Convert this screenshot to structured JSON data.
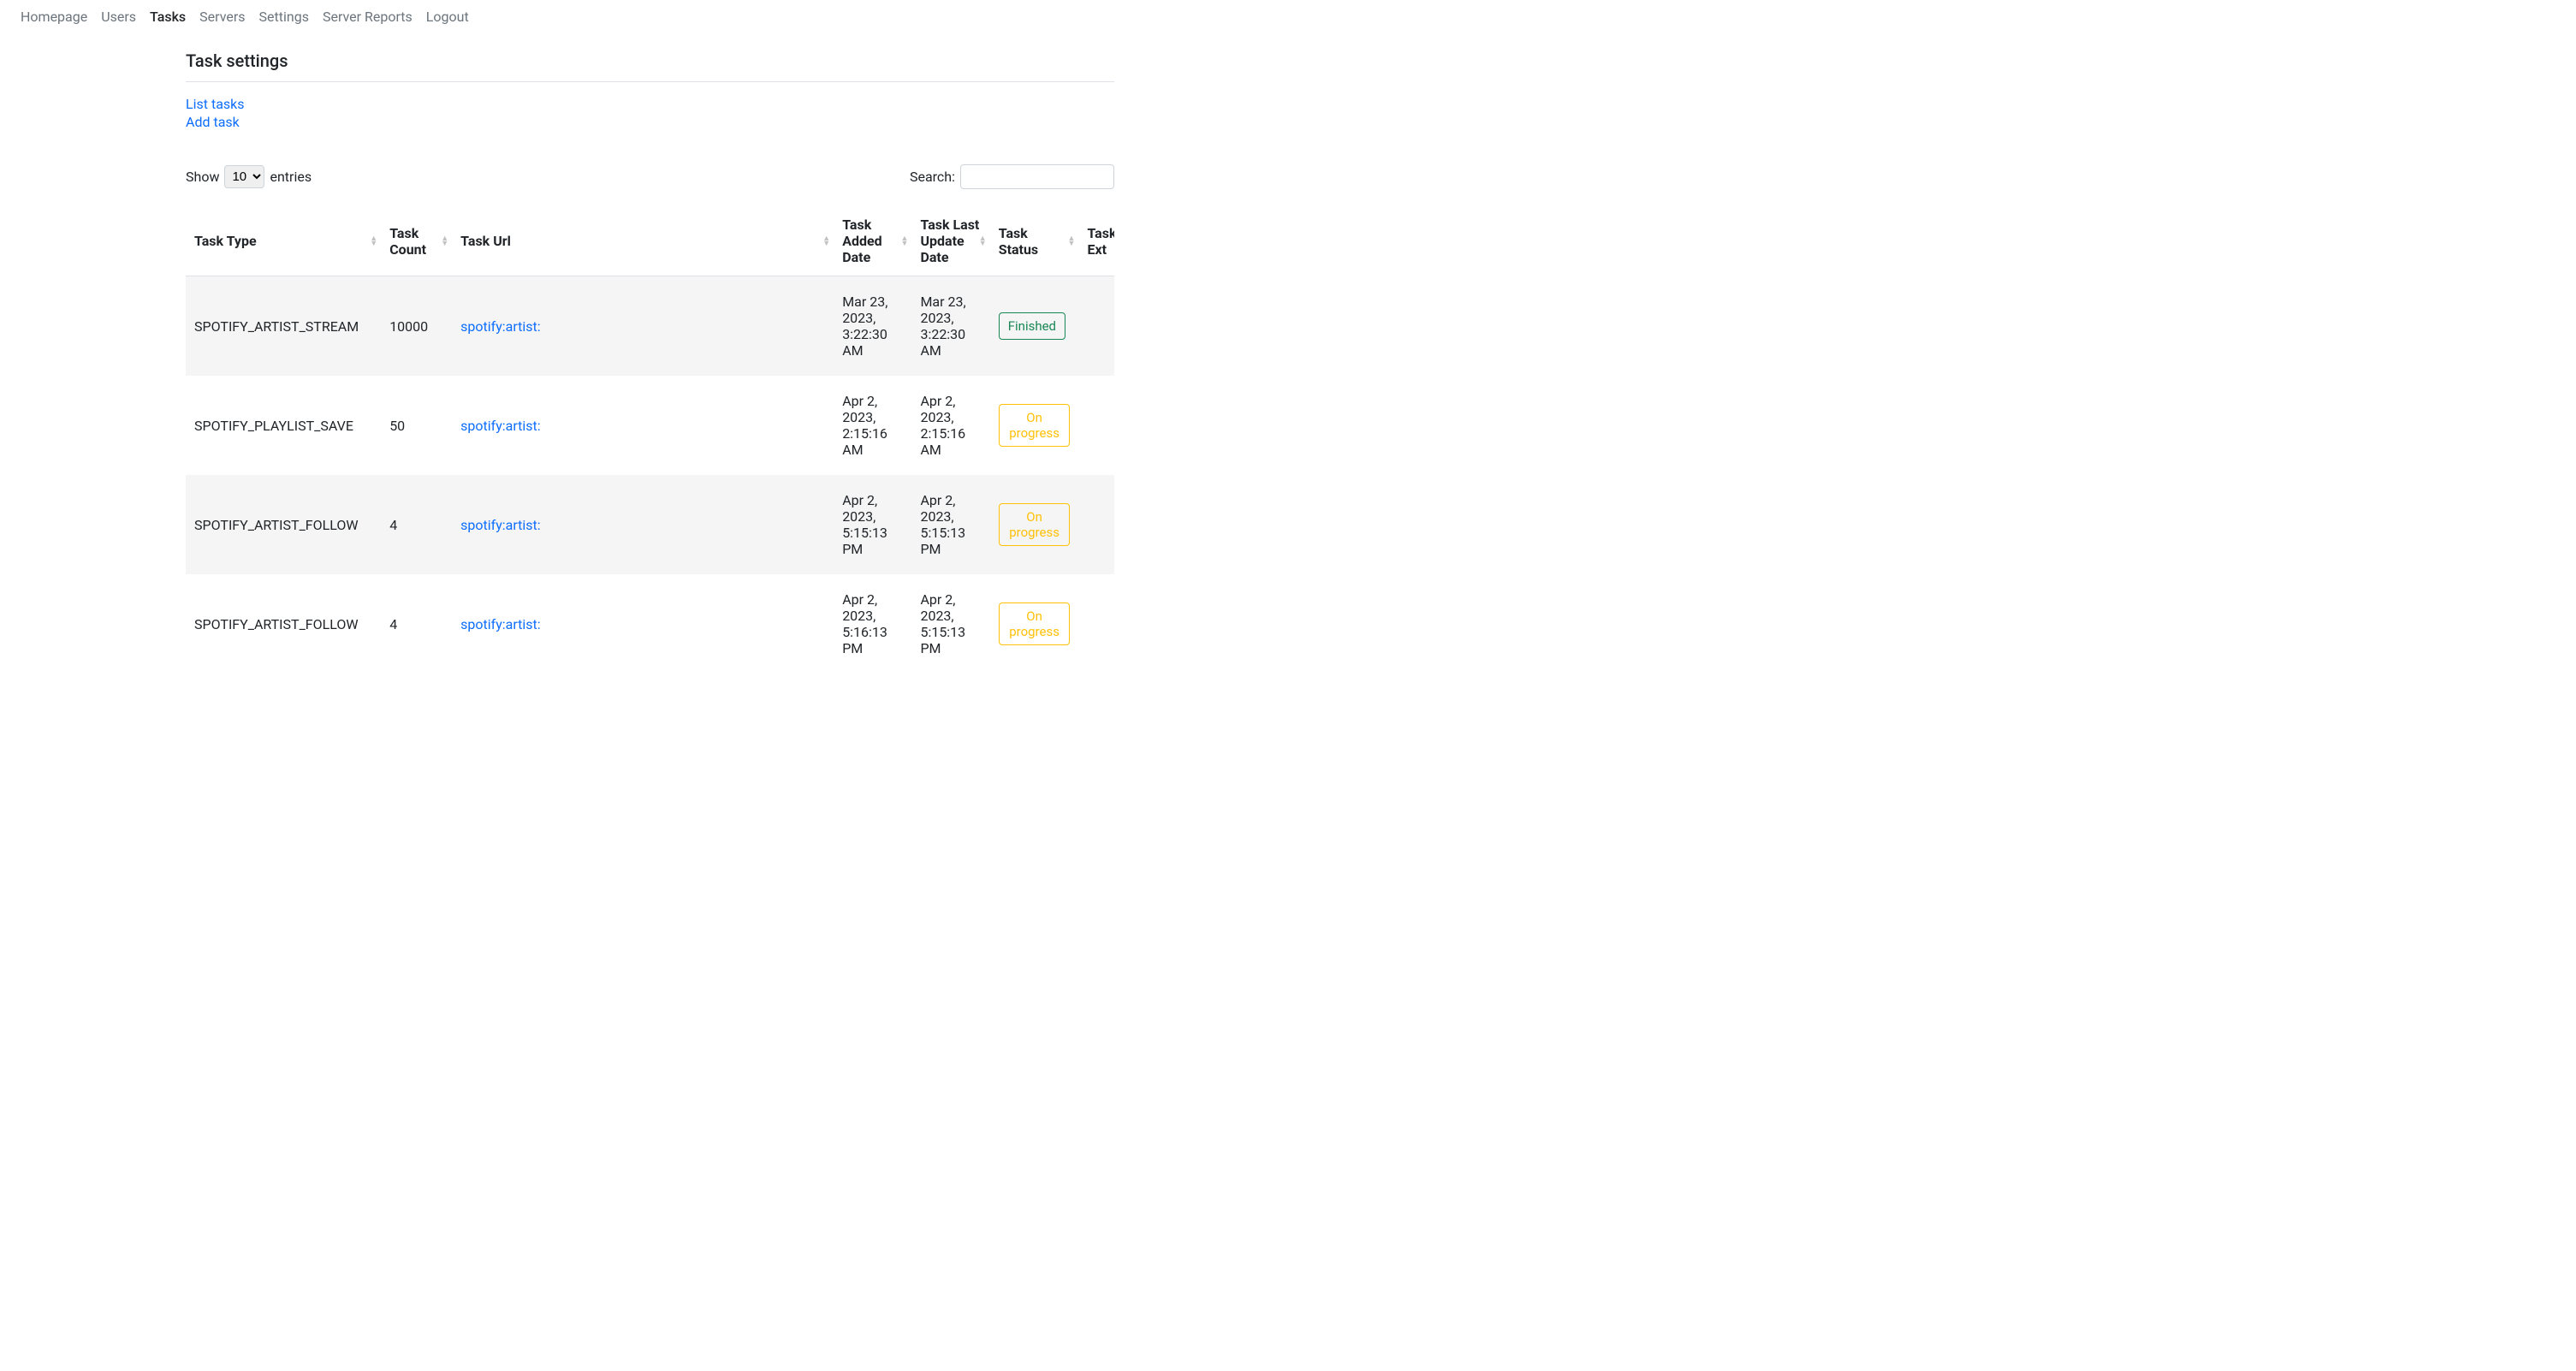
{
  "nav": {
    "items": [
      {
        "label": "Homepage",
        "active": false
      },
      {
        "label": "Users",
        "active": false
      },
      {
        "label": "Tasks",
        "active": true
      },
      {
        "label": "Servers",
        "active": false
      },
      {
        "label": "Settings",
        "active": false
      },
      {
        "label": "Server Reports",
        "active": false
      },
      {
        "label": "Logout",
        "active": false
      }
    ]
  },
  "page": {
    "title": "Task settings",
    "sublinks": [
      {
        "label": "List tasks"
      },
      {
        "label": "Add task"
      }
    ]
  },
  "table_controls": {
    "show_prefix": "Show",
    "show_suffix": "entries",
    "entries_selected": "10",
    "entries_options": [
      "10"
    ],
    "search_label": "Search:",
    "search_value": ""
  },
  "columns": [
    {
      "label": "Task Type",
      "cls": "col-type"
    },
    {
      "label": "Task Count",
      "cls": "col-count"
    },
    {
      "label": "Task Url",
      "cls": "col-url"
    },
    {
      "label": "Task Added Date",
      "cls": "col-added"
    },
    {
      "label": "Task Last Update Date",
      "cls": "col-update"
    },
    {
      "label": "Task Status",
      "cls": "col-status"
    },
    {
      "label": "Task Ext",
      "cls": "col-ext"
    }
  ],
  "rows": [
    {
      "type": "SPOTIFY_ARTIST_STREAM",
      "count": "10000",
      "url": "spotify:artist:",
      "added": "Mar 23, 2023, 3:22:30 AM",
      "updated": "Mar 23, 2023, 3:22:30 AM",
      "status": "Finished",
      "status_kind": "finished"
    },
    {
      "type": "SPOTIFY_PLAYLIST_SAVE",
      "count": "50",
      "url": "spotify:artist:",
      "added": "Apr 2, 2023, 2:15:16 AM",
      "updated": "Apr 2, 2023, 2:15:16 AM",
      "status": "On progress",
      "status_kind": "progress"
    },
    {
      "type": "SPOTIFY_ARTIST_FOLLOW",
      "count": "4",
      "url": "spotify:artist:",
      "added": "Apr 2, 2023, 5:15:13 PM",
      "updated": "Apr 2, 2023, 5:15:13 PM",
      "status": "On progress",
      "status_kind": "progress"
    },
    {
      "type": "SPOTIFY_ARTIST_FOLLOW",
      "count": "4",
      "url": "spotify:artist:",
      "added": "Apr 2, 2023, 5:16:13 PM",
      "updated": "Apr 2, 2023, 5:15:13 PM",
      "status": "On progress",
      "status_kind": "progress"
    }
  ]
}
